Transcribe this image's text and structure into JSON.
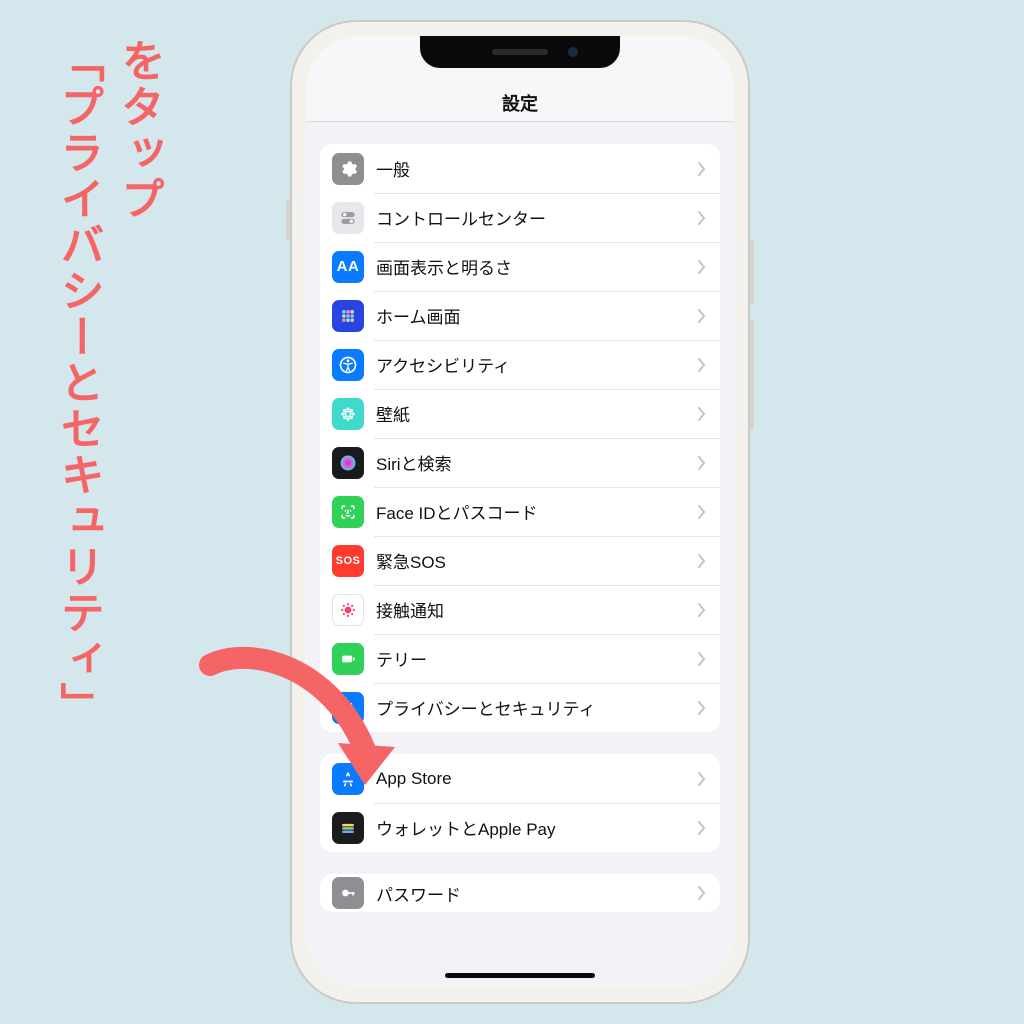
{
  "annotation": {
    "line1": "「プライバシーとセキュリティ」",
    "line2": "をタップ",
    "color": "#f56565"
  },
  "header": {
    "title": "設定"
  },
  "groups": [
    {
      "rows": [
        {
          "icon": "gear-icon",
          "label": "一般"
        },
        {
          "icon": "switches-icon",
          "label": "コントロールセンター"
        },
        {
          "icon": "textsize-icon",
          "label": "画面表示と明るさ"
        },
        {
          "icon": "homescreen-icon",
          "label": "ホーム画面"
        },
        {
          "icon": "accessibility-icon",
          "label": "アクセシビリティ"
        },
        {
          "icon": "wallpaper-icon",
          "label": "壁紙"
        },
        {
          "icon": "siri-icon",
          "label": "Siriと検索"
        },
        {
          "icon": "faceid-icon",
          "label": "Face IDとパスコード"
        },
        {
          "icon": "sos-icon",
          "label": "緊急SOS"
        },
        {
          "icon": "exposure-icon",
          "label": "接触通知"
        },
        {
          "icon": "battery-icon",
          "label": "テリー"
        },
        {
          "icon": "privacy-icon",
          "label": "プライバシーとセキュリティ"
        }
      ]
    },
    {
      "rows": [
        {
          "icon": "appstore-icon",
          "label": "App Store"
        },
        {
          "icon": "wallet-icon",
          "label": "ウォレットとApple Pay"
        }
      ]
    },
    {
      "rows": [
        {
          "icon": "passwords-icon",
          "label": "パスワード"
        }
      ],
      "partial": true
    }
  ]
}
